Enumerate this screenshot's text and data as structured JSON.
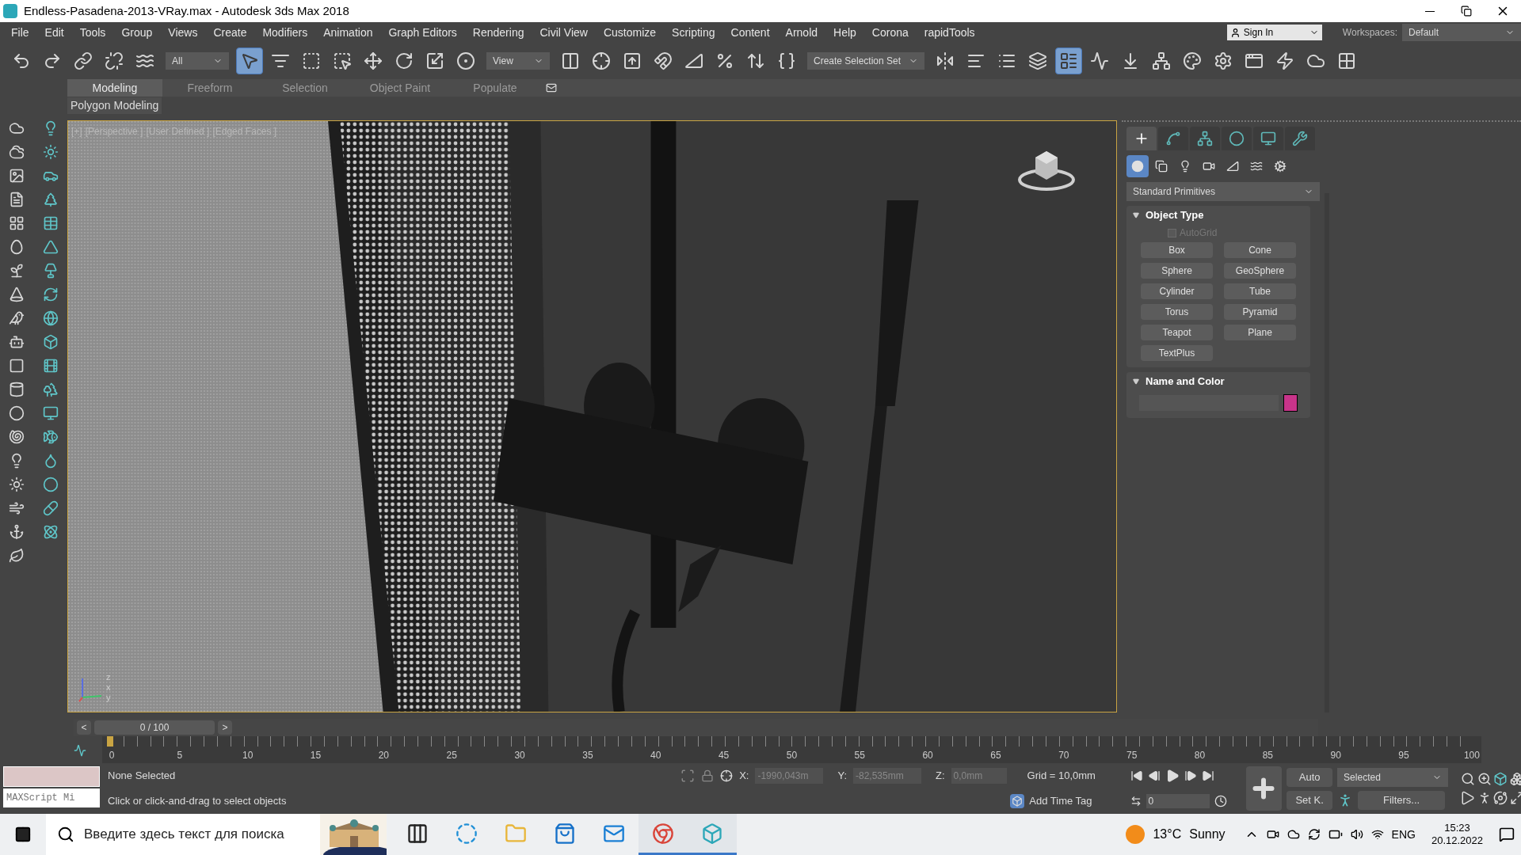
{
  "window": {
    "title": "Endless-Pasadena-2013-VRay.max - Autodesk 3ds Max 2018"
  },
  "menu": [
    "File",
    "Edit",
    "Tools",
    "Group",
    "Views",
    "Create",
    "Modifiers",
    "Animation",
    "Graph Editors",
    "Rendering",
    "Civil View",
    "Customize",
    "Scripting",
    "Content",
    "Arnold",
    "Help",
    "Corona",
    "rapidTools"
  ],
  "account": {
    "sign_in": "Sign In",
    "workspaces_label": "Workspaces:",
    "workspace": "Default"
  },
  "toolbar": {
    "selection_filter": "All",
    "reference_coord": "View",
    "selection_set": "Create Selection Set",
    "buttons": [
      {
        "kind": "undo",
        "selected": false
      },
      {
        "kind": "redo",
        "selected": false
      },
      {
        "kind": "link",
        "selected": false
      },
      {
        "kind": "unlink",
        "selected": false
      },
      {
        "kind": "bind",
        "selected": false
      },
      {
        "kind": "filter"
      },
      {
        "kind": "select",
        "selected": true
      },
      {
        "kind": "select-by-name",
        "selected": false
      },
      {
        "kind": "region",
        "selected": false
      },
      {
        "kind": "window",
        "selected": false
      },
      {
        "kind": "move",
        "selected": false
      },
      {
        "kind": "rotate",
        "selected": false
      },
      {
        "kind": "scale",
        "selected": false
      },
      {
        "kind": "place",
        "selected": false
      },
      {
        "kind": "coord"
      },
      {
        "kind": "pivot",
        "selected": false
      },
      {
        "kind": "manipulate",
        "selected": false
      },
      {
        "kind": "keyboard",
        "selected": false
      },
      {
        "kind": "snap",
        "selected": false
      },
      {
        "kind": "angle",
        "selected": false
      },
      {
        "kind": "percent",
        "selected": false
      },
      {
        "kind": "spinner",
        "selected": false
      },
      {
        "kind": "named-sets",
        "selected": false
      },
      {
        "kind": "set"
      },
      {
        "kind": "mirror",
        "selected": false
      },
      {
        "kind": "align",
        "selected": false
      },
      {
        "kind": "layers",
        "selected": false
      },
      {
        "kind": "ribbon",
        "selected": false
      },
      {
        "kind": "explorer",
        "selected": true
      },
      {
        "kind": "curve",
        "selected": false
      },
      {
        "kind": "dope",
        "selected": false
      },
      {
        "kind": "schematic",
        "selected": false
      },
      {
        "kind": "material",
        "selected": false
      },
      {
        "kind": "render-setup",
        "selected": false
      },
      {
        "kind": "frame",
        "selected": false
      },
      {
        "kind": "render",
        "selected": false
      },
      {
        "kind": "cloud",
        "selected": false
      },
      {
        "kind": "grid",
        "selected": false
      }
    ]
  },
  "ribbon": {
    "tabs": [
      {
        "label": "Modeling",
        "selected": true
      },
      {
        "label": "Freeform",
        "selected": false
      },
      {
        "label": "Selection",
        "selected": false
      },
      {
        "label": "Object Paint",
        "selected": false
      },
      {
        "label": "Populate",
        "selected": false
      }
    ],
    "panel": "Polygon Modeling"
  },
  "viewport": {
    "labels": [
      "[+]",
      "[Perspective ]",
      "[User Defined ]",
      "[Edged Faces ]"
    ],
    "axis_labels": [
      "z",
      "x",
      "y"
    ]
  },
  "command_panel": {
    "tabs": [
      {
        "kind": "create",
        "selected": true
      },
      {
        "kind": "modify",
        "selected": false
      },
      {
        "kind": "hierarchy",
        "selected": false
      },
      {
        "kind": "motion",
        "selected": false
      },
      {
        "kind": "display",
        "selected": false
      },
      {
        "kind": "utilities",
        "selected": false
      }
    ],
    "categories": [
      {
        "kind": "geometry",
        "selected": true
      },
      {
        "kind": "shapes",
        "selected": false
      },
      {
        "kind": "lights",
        "selected": false
      },
      {
        "kind": "cameras",
        "selected": false
      },
      {
        "kind": "helpers",
        "selected": false
      },
      {
        "kind": "spacewarps",
        "selected": false
      },
      {
        "kind": "systems",
        "selected": false
      }
    ],
    "dropdown": "Standard Primitives",
    "object_type": {
      "title": "Object Type",
      "expanded": true,
      "autogrid": {
        "label": "AutoGrid",
        "checked": false,
        "disabled": true
      },
      "buttons": [
        "Box",
        "Cone",
        "Sphere",
        "GeoSphere",
        "Cylinder",
        "Tube",
        "Torus",
        "Pyramid",
        "Teapot",
        "Plane",
        "TextPlus"
      ]
    },
    "name_and_color": {
      "title": "Name and Color",
      "expanded": true,
      "color": "#c8348a"
    }
  },
  "timeline": {
    "prev": "<",
    "position": "0 / 100",
    "next": ">",
    "ticks": [
      "0",
      "5",
      "10",
      "15",
      "20",
      "25",
      "30",
      "35",
      "40",
      "45",
      "50",
      "55",
      "60",
      "65",
      "70",
      "75",
      "80",
      "85",
      "90",
      "95",
      "100"
    ],
    "level": 0
  },
  "status": {
    "maxscript": "MAXScript Mi",
    "selection": "None Selected",
    "prompt": "Click or click-and-drag to select objects",
    "x_label": "X:",
    "x": "-1990,043m",
    "y_label": "Y:",
    "y": "-82,535mm",
    "z_label": "Z:",
    "z": "0,0mm",
    "grid": "Grid = 10,0mm",
    "time_tag": "Add Time Tag",
    "frame": "0",
    "auto": "Auto",
    "key_filter": "Selected",
    "set_key": "Set K.",
    "filters": "Filters..."
  },
  "taskbar": {
    "search_placeholder": "Введите здесь текст для поиска",
    "apps": [
      {
        "kind": "taskview",
        "active": false
      },
      {
        "kind": "edge",
        "active": false
      },
      {
        "kind": "explorer",
        "active": false
      },
      {
        "kind": "store",
        "active": false
      },
      {
        "kind": "mail",
        "active": false
      },
      {
        "kind": "chrome",
        "active": true
      },
      {
        "kind": "max",
        "active": true
      }
    ],
    "temperature": "13°C",
    "weather": "Sunny",
    "language": "ENG",
    "time": "15:23",
    "date": "20.12.2022"
  }
}
